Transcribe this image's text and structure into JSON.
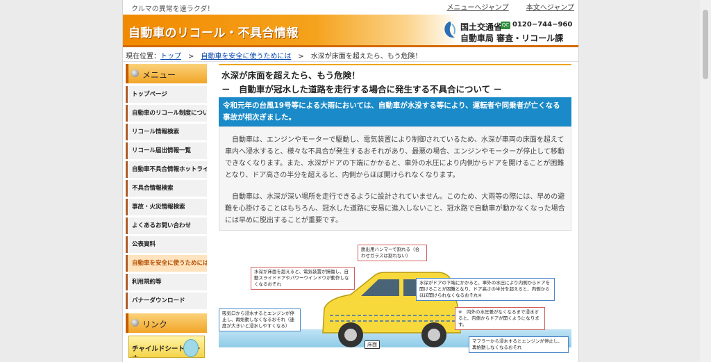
{
  "top": {
    "tagline": "クルマの異常を速ラクダ！",
    "links": [
      "メニューへジャンプ",
      "本文へジャンプ"
    ]
  },
  "header": {
    "site_title": "自動車のリコール・不具合情報",
    "ministry_name": "国土交通省",
    "tel_badge": "QC",
    "tel_number": "0120−744−960",
    "department": "自動車局 審査・リコール課"
  },
  "breadcrumb": {
    "prefix": "現在位置：",
    "items": [
      "トップ",
      "自動車を安全に使うためには",
      "水深が床面を超えたら、もう危険！"
    ]
  },
  "sidebar": {
    "menu_title": "メニュー",
    "items": [
      "トップページ",
      "自動車のリコール制度について",
      "リコール情報検索",
      "リコール届出情報一覧",
      "自動車不具合情報ホットライン",
      "不具合情報検索",
      "事故・火災情報検索",
      "よくあるお問い合わせ",
      "公表資料",
      "自動車を安全に使うためには",
      "利用規約等",
      "バナーダウンロード"
    ],
    "link_title": "リンク",
    "banner_text": "チャイルドシート コーナー"
  },
  "article": {
    "title": "水深が床面を超えたら、もう危険！",
    "subtitle": "－　自動車が冠水した道路を走行する場合に発生する不具合について －",
    "lead": "令和元年の台風19号等による大雨においては、自動車が水没する等により、運転者や同乗者が亡くなる事故が相次ぎました。",
    "paragraphs": [
      "自動車は、エンジンやモーターで駆動し、電気装置により制御されているため、水深が車両の床面を超えて車内へ浸水すると、様々な不具合が発生するおそれがあり、最悪の場合、エンジンやモーターが停止して移動できなくなります。また、水深がドアの下端にかかると、車外の水圧により内側からドアを開けることが困難となり、ドア高さの半分を超えると、内側からほぼ開けられなくなります。",
      "自動車は、水深が深い場所を走行できるように設計されていません。このため、大雨等の際には、早めの避難を心掛けることはもちろん、冠水した道路に安易に進入しないこと、冠水路で自動車が動かなくなった場合には早めに脱出することが重要です。"
    ]
  },
  "illustration": {
    "hammer": "脱出用ハンマーで割れる（合わせガラスは割れない）",
    "floor_over": "水深が床面を超えると、電気装置が損傷し、自動スライドドアやパワーウインドウが動作しなくなるおそれ",
    "door": "水深がドアの下端にかかると、車外の水圧により内側からドアを開けることが困難となり、ドア高さの半分を超えると、内側からほぼ開けられなくなるおそれ※",
    "door_note": "※　内外の水圧差がなくなるまで浸水すると、内側からドアが開くようになります。",
    "intake": "吸気口から浸水するとエンジンが停止し、再始動しなくなるおそれ（速度が大きいと浸水しやすくなる）",
    "muffler": "マフラーから浸水するとエンジンが停止し、再始動しなくなるおそれ",
    "floor_label": "床面"
  }
}
